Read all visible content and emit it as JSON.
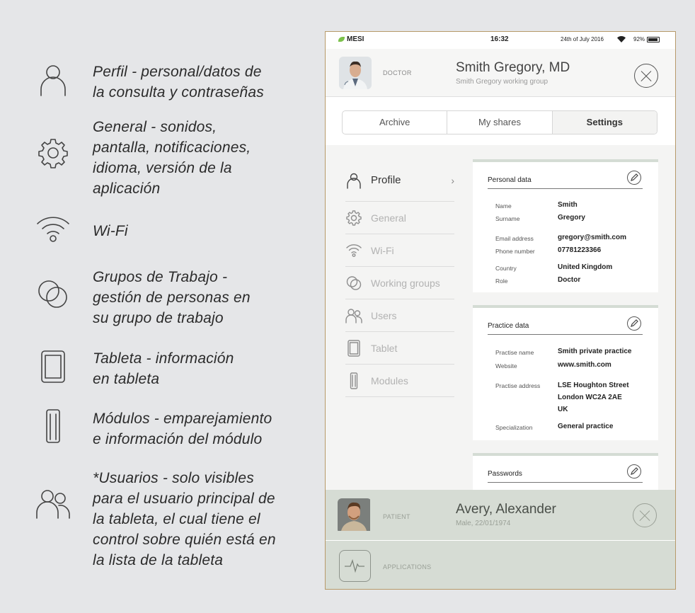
{
  "legend": [
    {
      "icon": "user-icon",
      "text": "Perfil - personal/datos de\nla consulta y contraseñas"
    },
    {
      "icon": "gear-icon",
      "text": "General - sonidos,\npantalla, notificaciones,\nidioma, versión de la\naplicación"
    },
    {
      "icon": "wifi-icon",
      "text": "Wi-Fi"
    },
    {
      "icon": "working-groups-icon",
      "text": "Grupos de Trabajo -\ngestión de personas en\nsu grupo de trabajo"
    },
    {
      "icon": "tablet-icon",
      "text": "Tableta - información\nen tableta"
    },
    {
      "icon": "module-icon",
      "text": "Módulos - emparejamiento\ne información del módulo"
    },
    {
      "icon": "users-icon",
      "text": "*Usuarios - solo visibles\npara el usuario principal de\nla tableta, el cual tiene el\ncontrol sobre quién está en\nla lista de la tableta"
    }
  ],
  "status": {
    "brand": "MESI",
    "time": "16:32",
    "date": "24th of July 2016",
    "battery": "92%"
  },
  "doctor": {
    "role": "DOCTOR",
    "name": "Smith Gregory, MD",
    "group": "Smith Gregory working group"
  },
  "tabs": [
    {
      "label": "Archive"
    },
    {
      "label": "My shares"
    },
    {
      "label": "Settings"
    }
  ],
  "menu": [
    {
      "label": "Profile",
      "icon": "user-icon"
    },
    {
      "label": "General",
      "icon": "gear-icon"
    },
    {
      "label": "Wi-Fi",
      "icon": "wifi-icon"
    },
    {
      "label": "Working groups",
      "icon": "working-groups-icon"
    },
    {
      "label": "Users",
      "icon": "users-icon"
    },
    {
      "label": "Tablet",
      "icon": "tablet-icon"
    },
    {
      "label": "Modules",
      "icon": "module-icon"
    }
  ],
  "personal": {
    "title": "Personal data",
    "rows": [
      {
        "label": "Name",
        "value": "Smith"
      },
      {
        "label": "Surname",
        "value": "Gregory"
      },
      {
        "label": "Email address",
        "value": "gregory@smith.com"
      },
      {
        "label": "Phone number",
        "value": "07781223366"
      },
      {
        "label": "Country",
        "value": "United Kingdom"
      },
      {
        "label": "Role",
        "value": "Doctor"
      }
    ]
  },
  "practice": {
    "title": "Practice data",
    "rows": [
      {
        "label": "Practise name",
        "value": "Smith private practice"
      },
      {
        "label": "Website",
        "value": "www.smith.com"
      },
      {
        "label": "Practise address",
        "value": "LSE Houghton Street\nLondon WC2A 2AE\nUK"
      },
      {
        "label": "Specialization",
        "value": "General practice"
      }
    ]
  },
  "passwords": {
    "title": "Passwords"
  },
  "patient": {
    "role": "PATIENT",
    "name": "Avery, Alexander",
    "info": "Male, 22/01/1974"
  },
  "applications": {
    "label": "APPLICATIONS"
  },
  "colors": {
    "background": "#e5e6e8",
    "footer": "#d6dcd4",
    "brand_green": "#7cc14b",
    "tablet_border": "#b79a6a"
  }
}
